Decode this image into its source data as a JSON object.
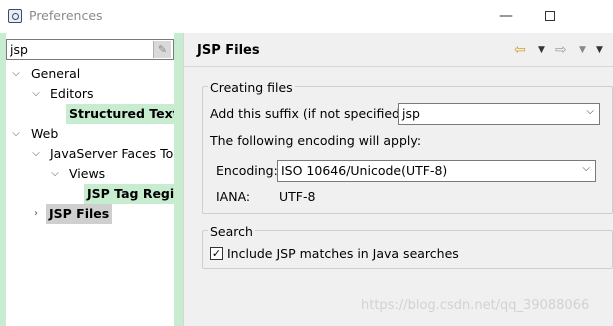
{
  "window": {
    "title": "Preferences"
  },
  "left": {
    "filter": {
      "value": "jsp"
    },
    "tree": [
      {
        "label": "General",
        "bold": false,
        "chevron": "open"
      },
      {
        "label": "Editors",
        "bold": false,
        "chevron": "open"
      },
      {
        "label": "Structured Text E",
        "bold": true,
        "chevron": "none"
      },
      {
        "label": "Web",
        "bold": false,
        "chevron": "open"
      },
      {
        "label": "JavaServer Faces Toc",
        "bold": false,
        "chevron": "open"
      },
      {
        "label": "Views",
        "bold": false,
        "chevron": "open"
      },
      {
        "label": "JSP Tag Regis",
        "bold": true,
        "chevron": "none"
      },
      {
        "label": "JSP Files",
        "bold": true,
        "chevron": "closed"
      }
    ]
  },
  "right": {
    "title": "JSP Files",
    "creating_group": {
      "legend": "Creating files",
      "suffix_label": "Add this suffix (if not specified):",
      "suffix_value": "jsp",
      "encoding_note": "The following encoding will apply:",
      "encoding_label": "Encoding:",
      "encoding_value": "ISO 10646/Unicode(UTF-8)",
      "iana_label": "IANA:",
      "iana_value": "UTF-8"
    },
    "search_group": {
      "legend": "Search",
      "include_label": "Include JSP matches in Java searches",
      "include_checked": true
    }
  },
  "watermark": "https://blog.csdn.net/qq_39088066"
}
